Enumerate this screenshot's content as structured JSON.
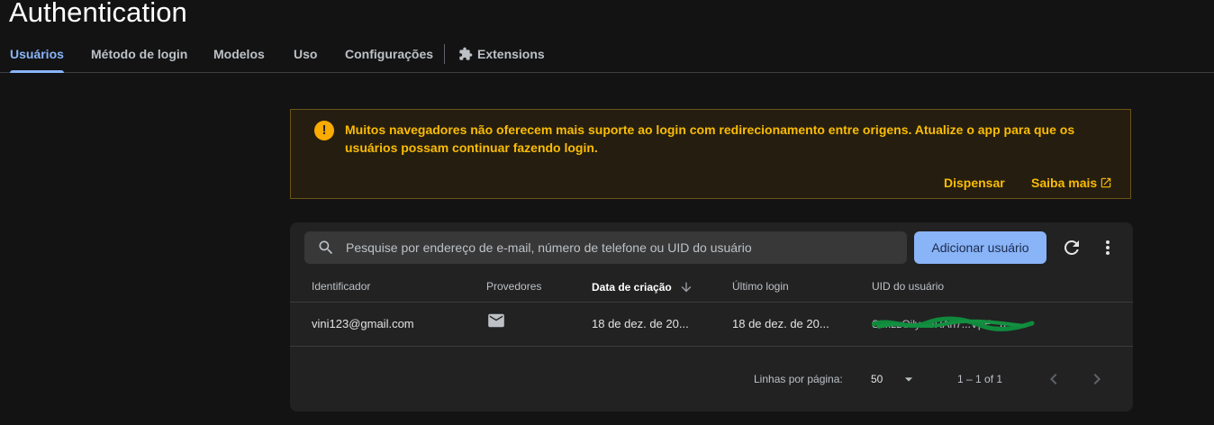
{
  "page": {
    "title": "Authentication"
  },
  "tabs": [
    {
      "label": "Usuários",
      "active": true
    },
    {
      "label": "Método de login",
      "active": false
    },
    {
      "label": "Modelos",
      "active": false
    },
    {
      "label": "Uso",
      "active": false
    },
    {
      "label": "Configurações",
      "active": false
    },
    {
      "label": "Extensions",
      "active": false,
      "icon": "extensions-icon"
    }
  ],
  "warning": {
    "icon": "warning-icon",
    "text": "Muitos navegadores não oferecem mais suporte ao login com redirecionamento entre origens. Atualize o app para que os usuários possam continuar fazendo login.",
    "dismiss_label": "Dispensar",
    "learn_more_label": "Saiba mais"
  },
  "users": {
    "search_placeholder": "Pesquise por endereço de e-mail, número de telefone ou UID do usuário",
    "search_value": "",
    "add_button_label": "Adicionar usuário",
    "columns": [
      "Identificador",
      "Provedores",
      "Data de criação",
      "Último login",
      "UID do usuário"
    ],
    "sorted_column": "Data de criação",
    "rows": [
      {
        "identifier": "vini123@gmail.com",
        "provider": "mail-icon",
        "created": "18 de dez. de 20...",
        "last_login": "18 de dez. de 20...",
        "uid": "Sr...zzOily...5RAh7...VpE...a..."
      }
    ],
    "pagination": {
      "rows_per_page_label": "Linhas por página:",
      "rows_per_page": "50",
      "range": "1 – 1 of 1"
    }
  },
  "colors": {
    "background": "#131313",
    "card": "#222222",
    "accent": "#8ab4f8",
    "warning_text": "#fbbc04",
    "warning_bg": "#251e10"
  }
}
